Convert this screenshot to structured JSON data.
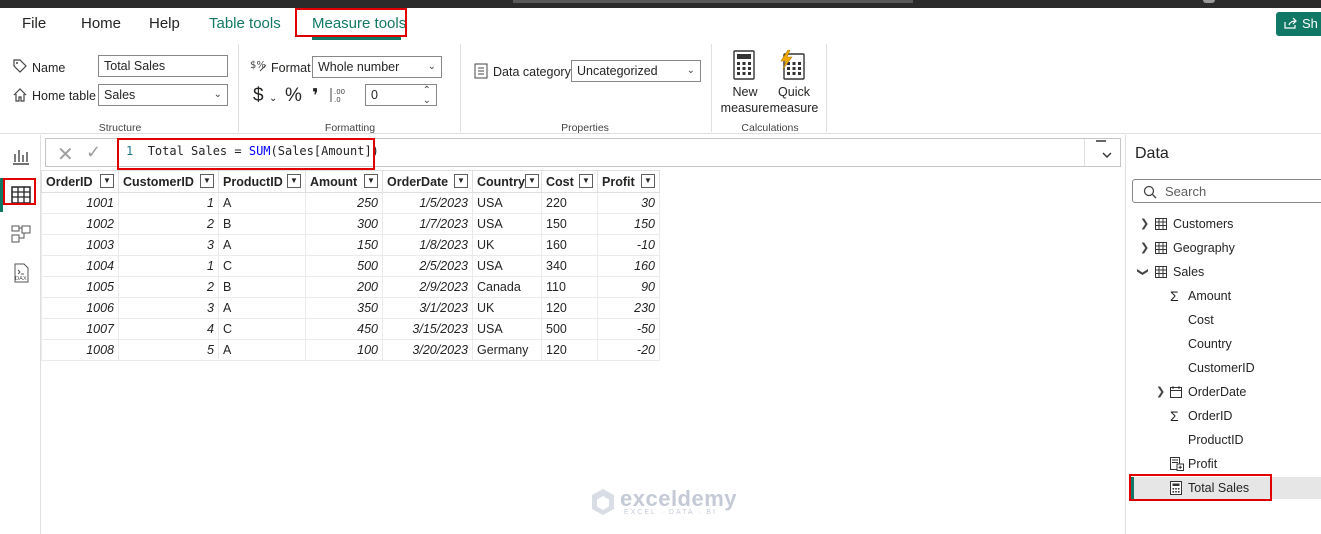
{
  "menu": {
    "file": "File",
    "home": "Home",
    "help": "Help",
    "table_tools": "Table tools",
    "measure_tools": "Measure tools",
    "share": "Sh"
  },
  "ribbon": {
    "structure": {
      "name_label": "Name",
      "name_value": "Total Sales",
      "home_table_label": "Home table",
      "home_table_value": "Sales",
      "title": "Structure"
    },
    "formatting": {
      "format_label": "Format",
      "format_value": "Whole number",
      "currency_symbol": "$",
      "percent_symbol": "%",
      "comma_symbol": "❜",
      "decimals_value": "0",
      "title": "Formatting"
    },
    "properties": {
      "data_category_label": "Data category",
      "data_category_value": "Uncategorized",
      "title": "Properties"
    },
    "calculations": {
      "new_measure_line1": "New",
      "new_measure_line2": "measure",
      "quick_measure_line1": "Quick",
      "quick_measure_line2": "measure",
      "title": "Calculations"
    }
  },
  "formula": {
    "line_number": "1",
    "prefix": "Total Sales = ",
    "function": "SUM",
    "args": "(Sales[Amount])"
  },
  "table": {
    "columns": [
      "OrderID",
      "CustomerID",
      "ProductID",
      "Amount",
      "OrderDate",
      "Country",
      "Cost",
      "Profit"
    ],
    "rows": [
      [
        "1001",
        "1",
        "A",
        "250",
        "1/5/2023",
        "USA",
        "220",
        "30"
      ],
      [
        "1002",
        "2",
        "B",
        "300",
        "1/7/2023",
        "USA",
        "150",
        "150"
      ],
      [
        "1003",
        "3",
        "A",
        "150",
        "1/8/2023",
        "UK",
        "160",
        "-10"
      ],
      [
        "1004",
        "1",
        "C",
        "500",
        "2/5/2023",
        "USA",
        "340",
        "160"
      ],
      [
        "1005",
        "2",
        "B",
        "200",
        "2/9/2023",
        "Canada",
        "110",
        "90"
      ],
      [
        "1006",
        "3",
        "A",
        "350",
        "3/1/2023",
        "UK",
        "120",
        "230"
      ],
      [
        "1007",
        "4",
        "C",
        "450",
        "3/15/2023",
        "USA",
        "500",
        "-50"
      ],
      [
        "1008",
        "5",
        "A",
        "100",
        "3/20/2023",
        "Germany",
        "120",
        "-20"
      ]
    ]
  },
  "data_panel": {
    "title": "Data",
    "search_placeholder": "Search",
    "tables": [
      "Customers",
      "Geography",
      "Sales"
    ],
    "sales_fields": [
      "Amount",
      "Cost",
      "Country",
      "CustomerID",
      "OrderDate",
      "OrderID",
      "ProductID",
      "Profit",
      "Total Sales"
    ]
  },
  "watermark": {
    "brand": "exceldemy",
    "tagline": "EXCEL · DATA · BI"
  },
  "colors": {
    "accent": "#117865",
    "highlight": "#e00000"
  }
}
